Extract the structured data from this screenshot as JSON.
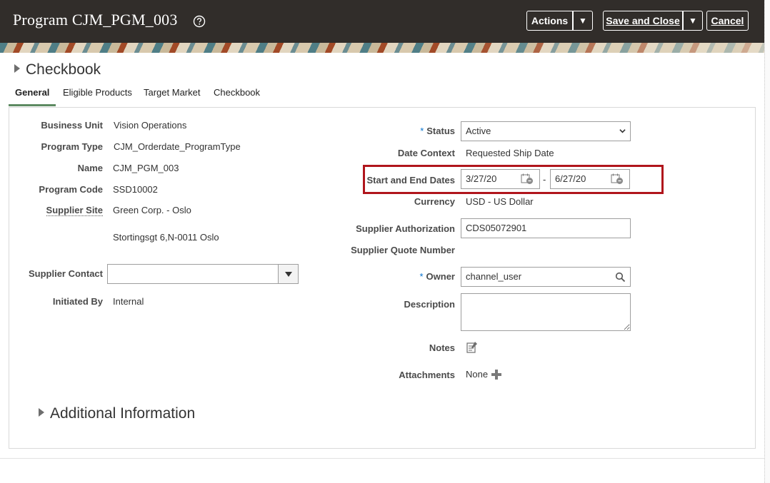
{
  "header": {
    "title": "Program CJM_PGM_003",
    "actions_label": "Actions",
    "save_close_label": "Save and Close",
    "cancel_label": "Cancel"
  },
  "section": {
    "title": "Checkbook"
  },
  "tabs": [
    {
      "label": "General",
      "active": true
    },
    {
      "label": "Eligible Products",
      "active": false
    },
    {
      "label": "Target Market",
      "active": false
    },
    {
      "label": "Checkbook",
      "active": false
    }
  ],
  "left": {
    "business_unit": {
      "label": "Business Unit",
      "value": "Vision Operations"
    },
    "program_type": {
      "label": "Program Type",
      "value": "CJM_Orderdate_ProgramType"
    },
    "name": {
      "label": "Name",
      "value": "CJM_PGM_003"
    },
    "program_code": {
      "label": "Program Code",
      "value": "SSD10002"
    },
    "supplier_site": {
      "label": "Supplier Site",
      "value": "Green Corp. - Oslo",
      "address": "Stortingsgt 6,N-0011 Oslo"
    },
    "supplier_contact": {
      "label": "Supplier Contact",
      "value": ""
    },
    "initiated_by": {
      "label": "Initiated By",
      "value": "Internal"
    }
  },
  "right": {
    "status": {
      "label": "Status",
      "value": "Active",
      "required": "*"
    },
    "date_context": {
      "label": "Date Context",
      "value": "Requested Ship Date"
    },
    "dates": {
      "label": "Start and End Dates",
      "start": "3/27/20",
      "separator": "-",
      "end": "6/27/20"
    },
    "currency": {
      "label": "Currency",
      "value": "USD - US Dollar"
    },
    "supplier_authorization": {
      "label": "Supplier Authorization",
      "value": "CDS05072901"
    },
    "supplier_quote_number": {
      "label": "Supplier Quote Number",
      "value": ""
    },
    "owner": {
      "label": "Owner",
      "value": "channel_user",
      "required": "*"
    },
    "description": {
      "label": "Description",
      "value": ""
    },
    "notes": {
      "label": "Notes"
    },
    "attachments": {
      "label": "Attachments",
      "value": "None"
    }
  },
  "additional": {
    "title": "Additional Information"
  },
  "colors": {
    "header_bg": "#312d2a",
    "highlight": "#b0151c",
    "tab_underline": "#5d8a62",
    "required": "#0572ce"
  },
  "icons": [
    "help-icon",
    "chevron-down-icon",
    "calendar-icon",
    "search-icon",
    "notes-icon",
    "plus-icon",
    "expand-triangle-icon"
  ]
}
